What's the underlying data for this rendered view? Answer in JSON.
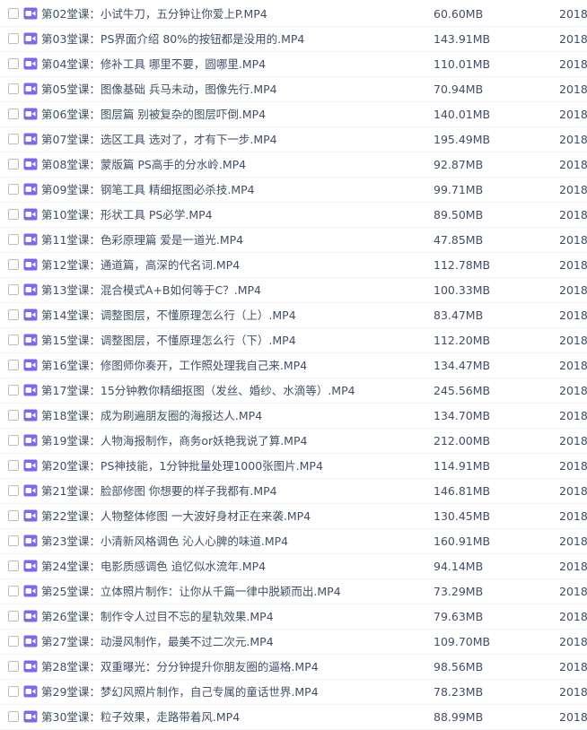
{
  "icon_color": "#7b68ee",
  "rows": [
    {
      "icon": "video-file-icon",
      "name": "第02堂课：小试牛刀，五分钟让你爱上P.MP4",
      "size": "60.60MB",
      "date": "2018-"
    },
    {
      "icon": "video-file-icon",
      "name": "第03堂课：PS界面介绍  80%的按钮都是没用的.MP4",
      "size": "143.91MB",
      "date": "2018-"
    },
    {
      "icon": "video-file-icon",
      "name": "第04堂课：修补工具  哪里不要，圆哪里.MP4",
      "size": "110.01MB",
      "date": "2018-"
    },
    {
      "icon": "video-file-icon",
      "name": "第05堂课：图像基础  兵马未动，图像先行.MP4",
      "size": "70.94MB",
      "date": "2018-"
    },
    {
      "icon": "video-file-icon",
      "name": "第06堂课：图层篇  别被复杂的图层吓倒.MP4",
      "size": "140.01MB",
      "date": "2018-"
    },
    {
      "icon": "video-file-icon",
      "name": "第07堂课：选区工具  选对了，才有下一步.MP4",
      "size": "195.49MB",
      "date": "2018-"
    },
    {
      "icon": "video-file-icon",
      "name": "第08堂课：蒙版篇  PS高手的分水岭.MP4",
      "size": "92.87MB",
      "date": "2018-"
    },
    {
      "icon": "video-file-icon",
      "name": "第09堂课：钢笔工具  精细抠图必杀技.MP4",
      "size": "99.71MB",
      "date": "2018-"
    },
    {
      "icon": "video-file-icon",
      "name": "第10堂课：形状工具  PS必学.MP4",
      "size": "89.50MB",
      "date": "2018-"
    },
    {
      "icon": "video-file-icon",
      "name": "第11堂课：色彩原理篇  爱是一道光.MP4",
      "size": "47.85MB",
      "date": "2018-"
    },
    {
      "icon": "video-file-icon",
      "name": "第12堂课：通道篇，高深的代名词.MP4",
      "size": "112.78MB",
      "date": "2018-"
    },
    {
      "icon": "video-file-icon",
      "name": "第13堂课：混合模式A+B如何等于C？.MP4",
      "size": "100.33MB",
      "date": "2018-"
    },
    {
      "icon": "video-file-icon",
      "name": "第14堂课：调整图层，不懂原理怎么行（上）.MP4",
      "size": "83.47MB",
      "date": "2018-"
    },
    {
      "icon": "video-file-icon",
      "name": "第15堂课：调整图层，不懂原理怎么行（下）.MP4",
      "size": "112.20MB",
      "date": "2018-"
    },
    {
      "icon": "video-file-icon",
      "name": "第16堂课：修图师你奏开，工作照处理我自己来.MP4",
      "size": "134.47MB",
      "date": "2018-"
    },
    {
      "icon": "video-file-icon",
      "name": "第17堂课：15分钟教你精细抠图（发丝、婚纱、水滴等）.MP4",
      "size": "245.56MB",
      "date": "2018-"
    },
    {
      "icon": "video-file-icon",
      "name": "第18堂课：成为刷遍朋友圈的海报达人.MP4",
      "size": "134.70MB",
      "date": "2018-"
    },
    {
      "icon": "video-file-icon",
      "name": "第19堂课：人物海报制作，商务or妖艳我说了算.MP4",
      "size": "212.00MB",
      "date": "2018-"
    },
    {
      "icon": "video-file-icon",
      "name": "第20堂课：PS神技能，1分钟批量处理1000张图片.MP4",
      "size": "114.91MB",
      "date": "2018-"
    },
    {
      "icon": "video-file-icon",
      "name": "第21堂课：脸部修图  你想要的样子我都有.MP4",
      "size": "146.81MB",
      "date": "2018-"
    },
    {
      "icon": "video-file-icon",
      "name": "第22堂课：人物整体修图  一大波好身材正在来袭.MP4",
      "size": "130.45MB",
      "date": "2018-"
    },
    {
      "icon": "video-file-icon",
      "name": "第23堂课：小清新风格调色  沁人心脾的味道.MP4",
      "size": "160.91MB",
      "date": "2018-"
    },
    {
      "icon": "video-file-icon",
      "name": "第24堂课：电影质感调色  追忆似水流年.MP4",
      "size": "94.14MB",
      "date": "2018-"
    },
    {
      "icon": "video-file-icon",
      "name": "第25堂课：立体照片制作：让你从千篇一律中脱颖而出.MP4",
      "size": "73.29MB",
      "date": "2018-"
    },
    {
      "icon": "video-file-icon",
      "name": "第26堂课：制作令人过目不忘的星轨效果.MP4",
      "size": "79.63MB",
      "date": "2018-"
    },
    {
      "icon": "video-file-icon",
      "name": "第27堂课：动漫风制作，最美不过二次元.MP4",
      "size": "109.70MB",
      "date": "2018-"
    },
    {
      "icon": "video-file-icon",
      "name": "第28堂课：双重曝光：分分钟提升你朋友圈的逼格.MP4",
      "size": "98.56MB",
      "date": "2018-"
    },
    {
      "icon": "video-file-icon",
      "name": "第29堂课：梦幻风照片制作，自己专属的童话世界.MP4",
      "size": "78.23MB",
      "date": "2018-"
    },
    {
      "icon": "video-file-icon",
      "name": "第30堂课：粒子效果，走路带着风.MP4",
      "size": "88.99MB",
      "date": "2018-"
    }
  ]
}
